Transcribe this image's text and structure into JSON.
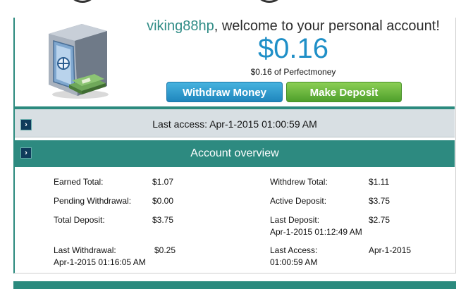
{
  "header": {
    "username": "viking88hp",
    "welcome_suffix": ", welcome to your personal account!",
    "balance": "$0.16",
    "balance_detail": "$0.16 of Perfectmoney",
    "withdraw_label": "Withdraw Money",
    "deposit_label": "Make Deposit"
  },
  "access": {
    "text": "Last access: Apr-1-2015 01:00:59 AM"
  },
  "overview": {
    "title": "Account overview",
    "earned_total_label": "Earned Total:",
    "earned_total_value": "$1.07",
    "pending_withdrawal_label": "Pending Withdrawal:",
    "pending_withdrawal_value": "$0.00",
    "total_deposit_label": "Total Deposit:",
    "total_deposit_value": "$3.75",
    "last_withdrawal_label": "Last Withdrawal:",
    "last_withdrawal_value": "$0.25",
    "last_withdrawal_date": "Apr-1-2015 01:16:05 AM",
    "withdrew_total_label": "Withdrew Total:",
    "withdrew_total_value": "$1.11",
    "active_deposit_label": "Active Deposit:",
    "active_deposit_value": "$3.75",
    "last_deposit_label": "Last Deposit:",
    "last_deposit_value": "$2.75",
    "last_deposit_date": "Apr-1-2015 01:12:49 AM",
    "last_access_label": "Last Access:",
    "last_access_value": "Apr-1-2015",
    "last_access_time": "01:00:59 AM"
  },
  "icons": {
    "safe": "safe-icon",
    "arrow": "chevron-right-icon"
  },
  "colors": {
    "accent_teal": "#2d8a80",
    "username": "#2f8c86",
    "balance": "#1f8fc7",
    "withdraw_button": "#2a94c9",
    "deposit_button": "#62ae38",
    "access_bar": "#d8dfe3"
  }
}
